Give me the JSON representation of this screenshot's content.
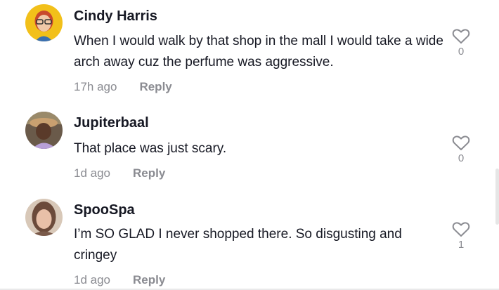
{
  "comments": [
    {
      "username": "Cindy Harris",
      "text": "When I would walk by that shop in the mall I would take a wide arch away cuz the perfume was aggressive.",
      "time": "17h ago",
      "reply_label": "Reply",
      "like_count": "0",
      "like_icon": "heart-outline-icon"
    },
    {
      "username": "Jupiterbaal",
      "text": "That place was just scary.",
      "time": "1d ago",
      "reply_label": "Reply",
      "like_count": "0",
      "like_icon": "heart-outline-icon"
    },
    {
      "username": "SpooSpa",
      "text": "I’m SO GLAD I never shopped there. So disgusting and cringey",
      "time": "1d ago",
      "reply_label": "Reply",
      "like_count": "1",
      "like_icon": "heart-outline-icon"
    }
  ],
  "colors": {
    "text": "#161823",
    "muted": "#8a8b91",
    "background": "#ffffff"
  }
}
